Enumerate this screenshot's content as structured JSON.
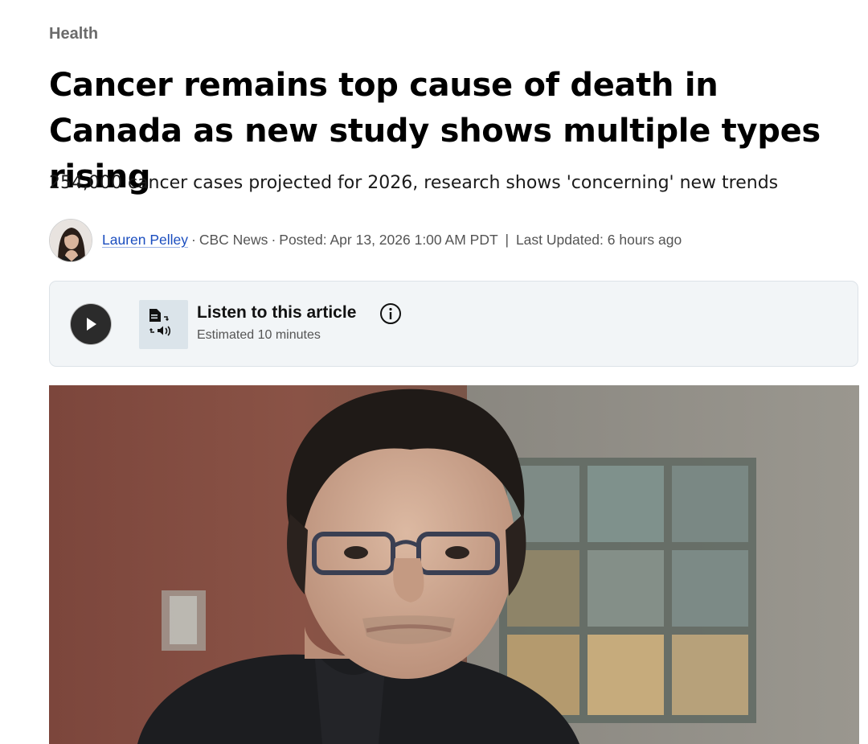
{
  "article": {
    "category": "Health",
    "headline": "Cancer remains top cause of death in Canada as new study shows multiple types rising",
    "deck": "254,000 cancer cases projected for 2026, research shows 'concerning' new trends",
    "byline": {
      "author": "Lauren Pelley",
      "outlet": "CBC News",
      "posted": "Posted: Apr 13, 2026 1:00 AM PDT",
      "updated": "Last Updated: 6 hours ago"
    }
  },
  "audio_player": {
    "title": "Listen to this article",
    "estimate": "Estimated 10 minutes",
    "play_icon": "play-icon",
    "tts_icon": "text-to-speech-icon",
    "info_icon": "info-icon"
  },
  "colors": {
    "link": "#1a4dbf",
    "meta_text": "#545454",
    "player_bg": "#f2f5f7",
    "play_button": "#2b2b2b"
  }
}
